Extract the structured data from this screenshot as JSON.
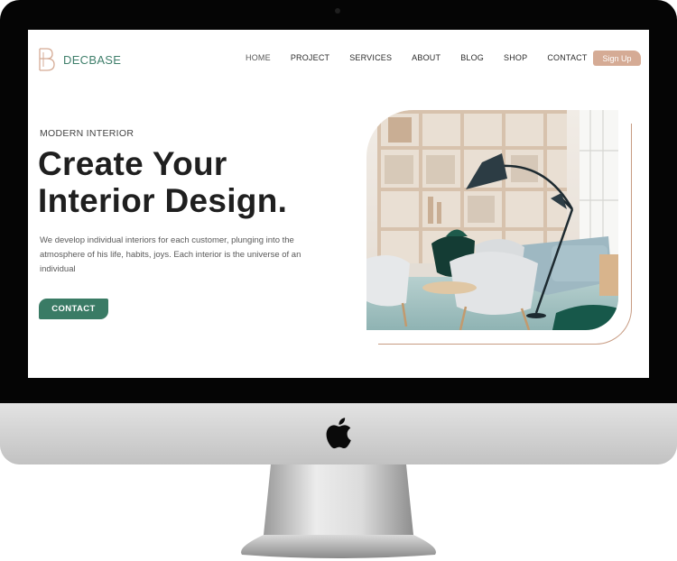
{
  "brand": {
    "name": "DECBASE"
  },
  "nav": {
    "items": [
      {
        "label": "HOME"
      },
      {
        "label": "PROJECT"
      },
      {
        "label": "SERVICES"
      },
      {
        "label": "ABOUT"
      },
      {
        "label": "BLOG"
      },
      {
        "label": "SHOP"
      },
      {
        "label": "CONTACT"
      }
    ],
    "signup_label": "Sign Up"
  },
  "hero": {
    "eyebrow": "MODERN INTERIOR",
    "headline_line1": "Create Your",
    "headline_line2": "Interior Design.",
    "description": "We develop individual interiors for each customer, plunging into the atmosphere of his life, habits, joys. Each interior is the universe of an individual",
    "cta_label": "CONTACT"
  },
  "colors": {
    "accent_green": "#3a7b65",
    "accent_tan": "#d5ab95"
  },
  "icons": {
    "brand_logo": "b-monogram-icon",
    "device_logo": "apple-logo-icon"
  }
}
